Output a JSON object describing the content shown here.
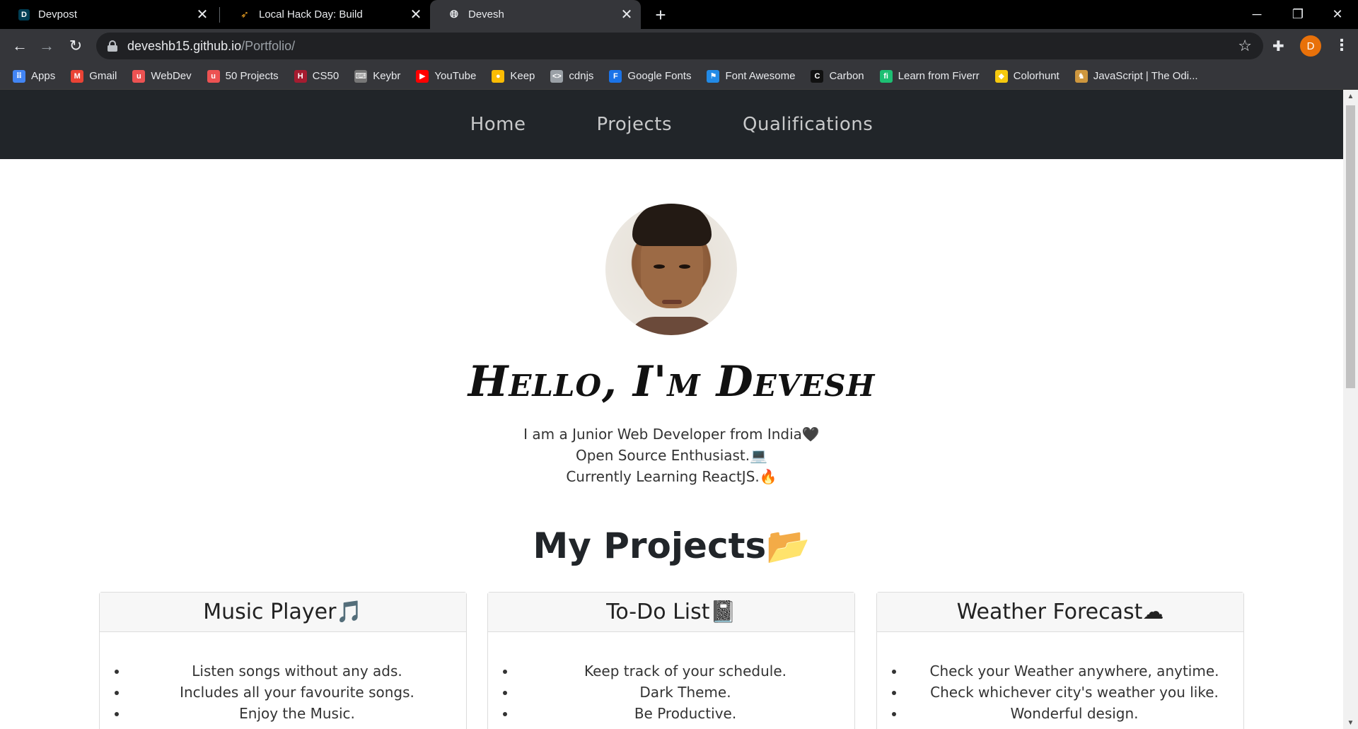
{
  "browser": {
    "tabs": [
      {
        "title": "Devpost",
        "favicon": "D",
        "favicon_color": "#003e54"
      },
      {
        "title": "Local Hack Day: Build",
        "favicon": "mlh-icon"
      },
      {
        "title": "Devesh",
        "favicon": "globe-icon"
      }
    ],
    "url_host": "deveshb15.github.io",
    "url_path": "/Portfolio/",
    "profile_initial": "D",
    "bookmarks": [
      {
        "label": "Apps",
        "icon": "apps-grid-icon",
        "color": "#4285f4"
      },
      {
        "label": "Gmail",
        "icon": "gmail-icon",
        "color": "#ea4335"
      },
      {
        "label": "WebDev",
        "icon": "udemy-icon",
        "color": "#ec5252"
      },
      {
        "label": "50 Projects",
        "icon": "udemy-icon",
        "color": "#ec5252"
      },
      {
        "label": "CS50",
        "icon": "harvard-icon",
        "color": "#a51c30"
      },
      {
        "label": "Keybr",
        "icon": "keyboard-icon",
        "color": "#777777"
      },
      {
        "label": "YouTube",
        "icon": "youtube-icon",
        "color": "#ff0000"
      },
      {
        "label": "Keep",
        "icon": "keep-icon",
        "color": "#fbbc04"
      },
      {
        "label": "cdnjs",
        "icon": "code-icon",
        "color": "#9aa0a6"
      },
      {
        "label": "Google Fonts",
        "icon": "google-fonts-icon",
        "color": "#1a73e8"
      },
      {
        "label": "Font Awesome",
        "icon": "flag-icon",
        "color": "#228ae6"
      },
      {
        "label": "Carbon",
        "icon": "carbon-icon",
        "color": "#111111"
      },
      {
        "label": "Learn from Fiverr",
        "icon": "fiverr-icon",
        "color": "#1dbf73"
      },
      {
        "label": "Colorhunt",
        "icon": "colorhunt-icon",
        "color": "#f6c90e"
      },
      {
        "label": "JavaScript | The Odi...",
        "icon": "odin-icon",
        "color": "#ce973e"
      }
    ]
  },
  "site": {
    "nav": [
      "Home",
      "Projects",
      "Qualifications"
    ],
    "hello": "Hello, I'm Devesh",
    "intro": [
      "I am a Junior Web Developer from India🖤",
      "Open Source Enthusiast.💻",
      "Currently Learning ReactJS.🔥"
    ],
    "projects_title": "My Projects📂",
    "cards": [
      {
        "title": "Music Player🎵",
        "items": [
          "Listen songs without any ads.",
          "Includes all your favourite songs.",
          "Enjoy the Music."
        ]
      },
      {
        "title": "To-Do List📓",
        "items": [
          "Keep track of your schedule.",
          "Dark Theme.",
          "Be Productive."
        ]
      },
      {
        "title": "Weather Forecast☁",
        "items": [
          "Check your Weather anywhere, anytime.",
          "Check whichever city's weather you like.",
          "Wonderful design."
        ]
      }
    ]
  }
}
